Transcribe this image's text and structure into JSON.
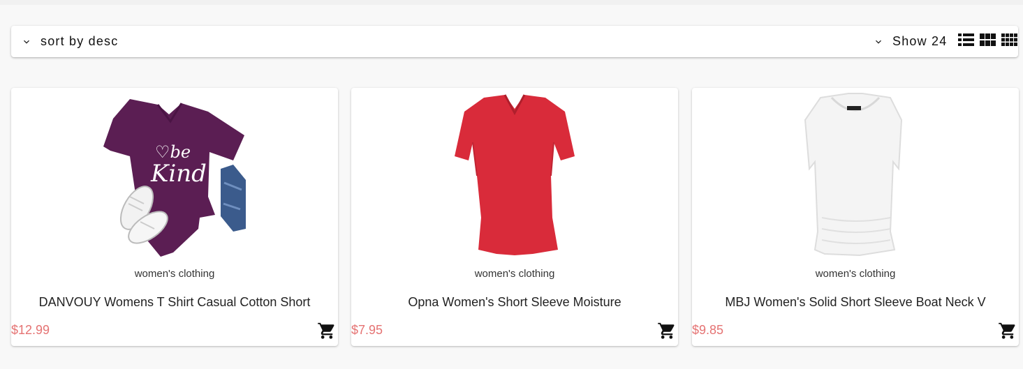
{
  "toolbar": {
    "sort_label": "sort by desc",
    "show_label": "Show 24",
    "view_modes": [
      "list-view-icon",
      "grid-view-icon",
      "compact-grid-view-icon"
    ]
  },
  "products": [
    {
      "category": "women's clothing",
      "title": "DANVOUY Womens T Shirt Casual Cotton Short",
      "price": "$12.99",
      "image": "purple-be-kind-tshirt-image",
      "color": "#5b1e53"
    },
    {
      "category": "women's clothing",
      "title": "Opna Women's Short Sleeve Moisture",
      "price": "$7.95",
      "image": "red-vneck-tshirt-image",
      "color": "#d92b3a"
    },
    {
      "category": "women's clothing",
      "title": "MBJ Women's Solid Short Sleeve Boat Neck V",
      "price": "$9.85",
      "image": "white-boatneck-top-image",
      "color": "#f4f4f4"
    }
  ],
  "colors": {
    "price": "#e57373",
    "background": "#f8f8f8",
    "card": "#ffffff"
  }
}
